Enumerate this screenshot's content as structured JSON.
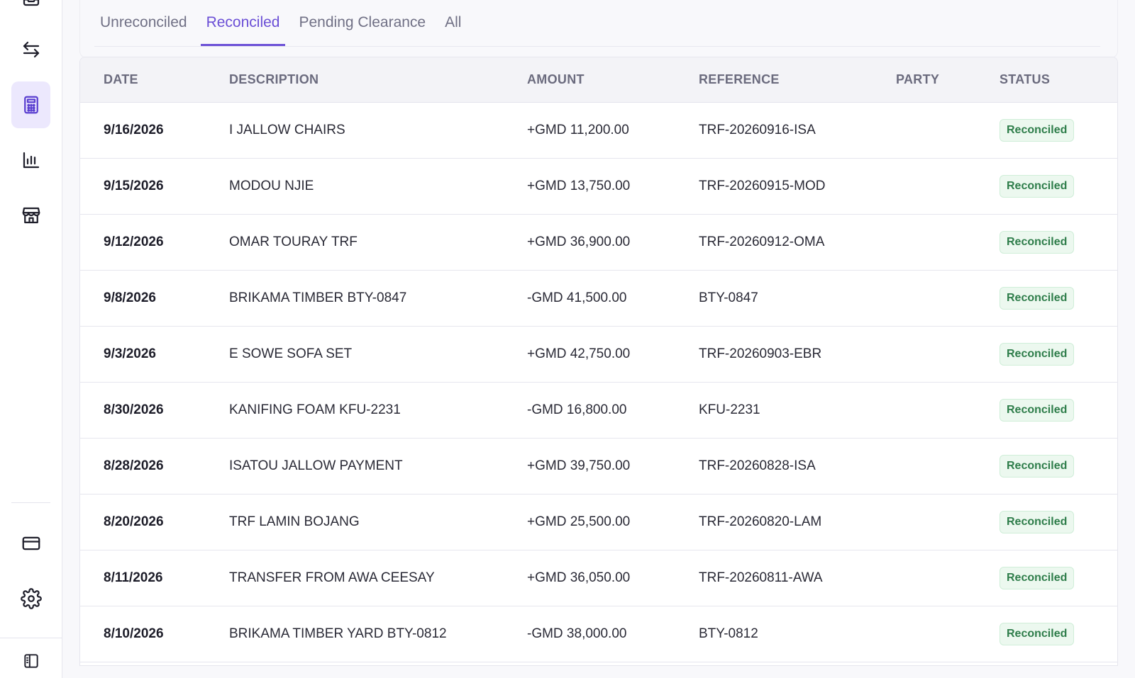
{
  "tabs": [
    {
      "label": "Unreconciled",
      "active": false
    },
    {
      "label": "Reconciled",
      "active": true
    },
    {
      "label": "Pending Clearance",
      "active": false
    },
    {
      "label": "All",
      "active": false
    }
  ],
  "table": {
    "columns": [
      "DATE",
      "DESCRIPTION",
      "AMOUNT",
      "REFERENCE",
      "PARTY",
      "STATUS"
    ],
    "rows": [
      {
        "date": "9/16/2026",
        "description": "I JALLOW CHAIRS",
        "amount": "+GMD 11,200.00",
        "reference": "TRF-20260916-ISA",
        "party": "",
        "status": "Reconciled"
      },
      {
        "date": "9/15/2026",
        "description": "MODOU NJIE",
        "amount": "+GMD 13,750.00",
        "reference": "TRF-20260915-MOD",
        "party": "",
        "status": "Reconciled"
      },
      {
        "date": "9/12/2026",
        "description": "OMAR TOURAY TRF",
        "amount": "+GMD 36,900.00",
        "reference": "TRF-20260912-OMA",
        "party": "",
        "status": "Reconciled"
      },
      {
        "date": "9/8/2026",
        "description": "BRIKAMA TIMBER BTY-0847",
        "amount": "-GMD 41,500.00",
        "reference": "BTY-0847",
        "party": "",
        "status": "Reconciled"
      },
      {
        "date": "9/3/2026",
        "description": "E SOWE SOFA SET",
        "amount": "+GMD 42,750.00",
        "reference": "TRF-20260903-EBR",
        "party": "",
        "status": "Reconciled"
      },
      {
        "date": "8/30/2026",
        "description": "KANIFING FOAM KFU-2231",
        "amount": "-GMD 16,800.00",
        "reference": "KFU-2231",
        "party": "",
        "status": "Reconciled"
      },
      {
        "date": "8/28/2026",
        "description": "ISATOU JALLOW PAYMENT",
        "amount": "+GMD 39,750.00",
        "reference": "TRF-20260828-ISA",
        "party": "",
        "status": "Reconciled"
      },
      {
        "date": "8/20/2026",
        "description": "TRF LAMIN BOJANG",
        "amount": "+GMD 25,500.00",
        "reference": "TRF-20260820-LAM",
        "party": "",
        "status": "Reconciled"
      },
      {
        "date": "8/11/2026",
        "description": "TRANSFER FROM AWA CEESAY",
        "amount": "+GMD 36,050.00",
        "reference": "TRF-20260811-AWA",
        "party": "",
        "status": "Reconciled"
      },
      {
        "date": "8/10/2026",
        "description": "BRIKAMA TIMBER YARD BTY-0812",
        "amount": "-GMD 38,000.00",
        "reference": "BTY-0812",
        "party": "",
        "status": "Reconciled"
      }
    ]
  },
  "sidebar": {
    "items": [
      {
        "icon": "inbox-icon"
      },
      {
        "icon": "transfer-arrows-icon"
      },
      {
        "icon": "calculator-icon",
        "active": true
      },
      {
        "icon": "bar-chart-icon"
      },
      {
        "icon": "store-icon"
      },
      {
        "icon": "credit-card-icon"
      },
      {
        "icon": "gear-icon"
      },
      {
        "icon": "sidebar-toggle-icon"
      }
    ]
  },
  "colors": {
    "accent": "#6b4fd6",
    "active_nav_bg": "#ece8fd",
    "badge_text": "#2e7d4a",
    "badge_bg": "#ecf8ef"
  }
}
